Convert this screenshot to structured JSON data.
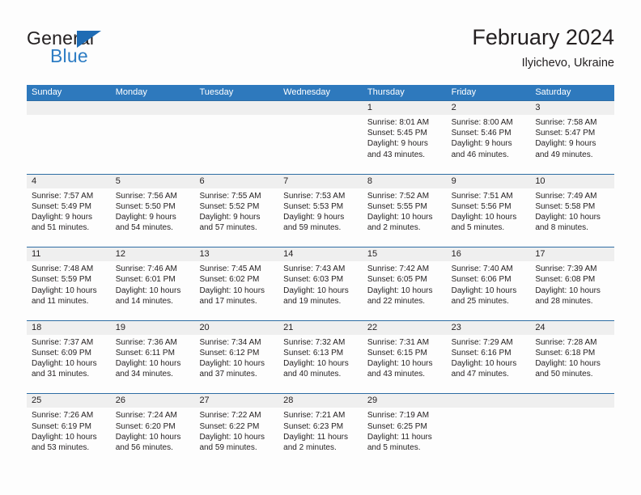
{
  "logo": {
    "word_one": "General",
    "word_two": "Blue",
    "triangle_icon": "blue-triangle-icon",
    "accent_dark": "#231f20",
    "accent_blue": "#2e7dc4"
  },
  "header": {
    "title": "February 2024",
    "subtitle": "Ilyichevo, Ukraine"
  },
  "theme": {
    "header_blue": "#2e79bd",
    "row_divider_blue": "#2e6da4",
    "daynum_band": "#efefef",
    "page_background": "#fdfdfd"
  },
  "calendar": {
    "weekday_headers": [
      "Sunday",
      "Monday",
      "Tuesday",
      "Wednesday",
      "Thursday",
      "Friday",
      "Saturday"
    ],
    "weeks": [
      [
        {
          "date": "",
          "sunrise": "",
          "sunset": "",
          "daylight_line1": "",
          "daylight_line2": ""
        },
        {
          "date": "",
          "sunrise": "",
          "sunset": "",
          "daylight_line1": "",
          "daylight_line2": ""
        },
        {
          "date": "",
          "sunrise": "",
          "sunset": "",
          "daylight_line1": "",
          "daylight_line2": ""
        },
        {
          "date": "",
          "sunrise": "",
          "sunset": "",
          "daylight_line1": "",
          "daylight_line2": ""
        },
        {
          "date": "1",
          "sunrise": "Sunrise: 8:01 AM",
          "sunset": "Sunset: 5:45 PM",
          "daylight_line1": "Daylight: 9 hours",
          "daylight_line2": "and 43 minutes."
        },
        {
          "date": "2",
          "sunrise": "Sunrise: 8:00 AM",
          "sunset": "Sunset: 5:46 PM",
          "daylight_line1": "Daylight: 9 hours",
          "daylight_line2": "and 46 minutes."
        },
        {
          "date": "3",
          "sunrise": "Sunrise: 7:58 AM",
          "sunset": "Sunset: 5:47 PM",
          "daylight_line1": "Daylight: 9 hours",
          "daylight_line2": "and 49 minutes."
        }
      ],
      [
        {
          "date": "4",
          "sunrise": "Sunrise: 7:57 AM",
          "sunset": "Sunset: 5:49 PM",
          "daylight_line1": "Daylight: 9 hours",
          "daylight_line2": "and 51 minutes."
        },
        {
          "date": "5",
          "sunrise": "Sunrise: 7:56 AM",
          "sunset": "Sunset: 5:50 PM",
          "daylight_line1": "Daylight: 9 hours",
          "daylight_line2": "and 54 minutes."
        },
        {
          "date": "6",
          "sunrise": "Sunrise: 7:55 AM",
          "sunset": "Sunset: 5:52 PM",
          "daylight_line1": "Daylight: 9 hours",
          "daylight_line2": "and 57 minutes."
        },
        {
          "date": "7",
          "sunrise": "Sunrise: 7:53 AM",
          "sunset": "Sunset: 5:53 PM",
          "daylight_line1": "Daylight: 9 hours",
          "daylight_line2": "and 59 minutes."
        },
        {
          "date": "8",
          "sunrise": "Sunrise: 7:52 AM",
          "sunset": "Sunset: 5:55 PM",
          "daylight_line1": "Daylight: 10 hours",
          "daylight_line2": "and 2 minutes."
        },
        {
          "date": "9",
          "sunrise": "Sunrise: 7:51 AM",
          "sunset": "Sunset: 5:56 PM",
          "daylight_line1": "Daylight: 10 hours",
          "daylight_line2": "and 5 minutes."
        },
        {
          "date": "10",
          "sunrise": "Sunrise: 7:49 AM",
          "sunset": "Sunset: 5:58 PM",
          "daylight_line1": "Daylight: 10 hours",
          "daylight_line2": "and 8 minutes."
        }
      ],
      [
        {
          "date": "11",
          "sunrise": "Sunrise: 7:48 AM",
          "sunset": "Sunset: 5:59 PM",
          "daylight_line1": "Daylight: 10 hours",
          "daylight_line2": "and 11 minutes."
        },
        {
          "date": "12",
          "sunrise": "Sunrise: 7:46 AM",
          "sunset": "Sunset: 6:01 PM",
          "daylight_line1": "Daylight: 10 hours",
          "daylight_line2": "and 14 minutes."
        },
        {
          "date": "13",
          "sunrise": "Sunrise: 7:45 AM",
          "sunset": "Sunset: 6:02 PM",
          "daylight_line1": "Daylight: 10 hours",
          "daylight_line2": "and 17 minutes."
        },
        {
          "date": "14",
          "sunrise": "Sunrise: 7:43 AM",
          "sunset": "Sunset: 6:03 PM",
          "daylight_line1": "Daylight: 10 hours",
          "daylight_line2": "and 19 minutes."
        },
        {
          "date": "15",
          "sunrise": "Sunrise: 7:42 AM",
          "sunset": "Sunset: 6:05 PM",
          "daylight_line1": "Daylight: 10 hours",
          "daylight_line2": "and 22 minutes."
        },
        {
          "date": "16",
          "sunrise": "Sunrise: 7:40 AM",
          "sunset": "Sunset: 6:06 PM",
          "daylight_line1": "Daylight: 10 hours",
          "daylight_line2": "and 25 minutes."
        },
        {
          "date": "17",
          "sunrise": "Sunrise: 7:39 AM",
          "sunset": "Sunset: 6:08 PM",
          "daylight_line1": "Daylight: 10 hours",
          "daylight_line2": "and 28 minutes."
        }
      ],
      [
        {
          "date": "18",
          "sunrise": "Sunrise: 7:37 AM",
          "sunset": "Sunset: 6:09 PM",
          "daylight_line1": "Daylight: 10 hours",
          "daylight_line2": "and 31 minutes."
        },
        {
          "date": "19",
          "sunrise": "Sunrise: 7:36 AM",
          "sunset": "Sunset: 6:11 PM",
          "daylight_line1": "Daylight: 10 hours",
          "daylight_line2": "and 34 minutes."
        },
        {
          "date": "20",
          "sunrise": "Sunrise: 7:34 AM",
          "sunset": "Sunset: 6:12 PM",
          "daylight_line1": "Daylight: 10 hours",
          "daylight_line2": "and 37 minutes."
        },
        {
          "date": "21",
          "sunrise": "Sunrise: 7:32 AM",
          "sunset": "Sunset: 6:13 PM",
          "daylight_line1": "Daylight: 10 hours",
          "daylight_line2": "and 40 minutes."
        },
        {
          "date": "22",
          "sunrise": "Sunrise: 7:31 AM",
          "sunset": "Sunset: 6:15 PM",
          "daylight_line1": "Daylight: 10 hours",
          "daylight_line2": "and 43 minutes."
        },
        {
          "date": "23",
          "sunrise": "Sunrise: 7:29 AM",
          "sunset": "Sunset: 6:16 PM",
          "daylight_line1": "Daylight: 10 hours",
          "daylight_line2": "and 47 minutes."
        },
        {
          "date": "24",
          "sunrise": "Sunrise: 7:28 AM",
          "sunset": "Sunset: 6:18 PM",
          "daylight_line1": "Daylight: 10 hours",
          "daylight_line2": "and 50 minutes."
        }
      ],
      [
        {
          "date": "25",
          "sunrise": "Sunrise: 7:26 AM",
          "sunset": "Sunset: 6:19 PM",
          "daylight_line1": "Daylight: 10 hours",
          "daylight_line2": "and 53 minutes."
        },
        {
          "date": "26",
          "sunrise": "Sunrise: 7:24 AM",
          "sunset": "Sunset: 6:20 PM",
          "daylight_line1": "Daylight: 10 hours",
          "daylight_line2": "and 56 minutes."
        },
        {
          "date": "27",
          "sunrise": "Sunrise: 7:22 AM",
          "sunset": "Sunset: 6:22 PM",
          "daylight_line1": "Daylight: 10 hours",
          "daylight_line2": "and 59 minutes."
        },
        {
          "date": "28",
          "sunrise": "Sunrise: 7:21 AM",
          "sunset": "Sunset: 6:23 PM",
          "daylight_line1": "Daylight: 11 hours",
          "daylight_line2": "and 2 minutes."
        },
        {
          "date": "29",
          "sunrise": "Sunrise: 7:19 AM",
          "sunset": "Sunset: 6:25 PM",
          "daylight_line1": "Daylight: 11 hours",
          "daylight_line2": "and 5 minutes."
        },
        {
          "date": "",
          "sunrise": "",
          "sunset": "",
          "daylight_line1": "",
          "daylight_line2": ""
        },
        {
          "date": "",
          "sunrise": "",
          "sunset": "",
          "daylight_line1": "",
          "daylight_line2": ""
        }
      ]
    ]
  }
}
